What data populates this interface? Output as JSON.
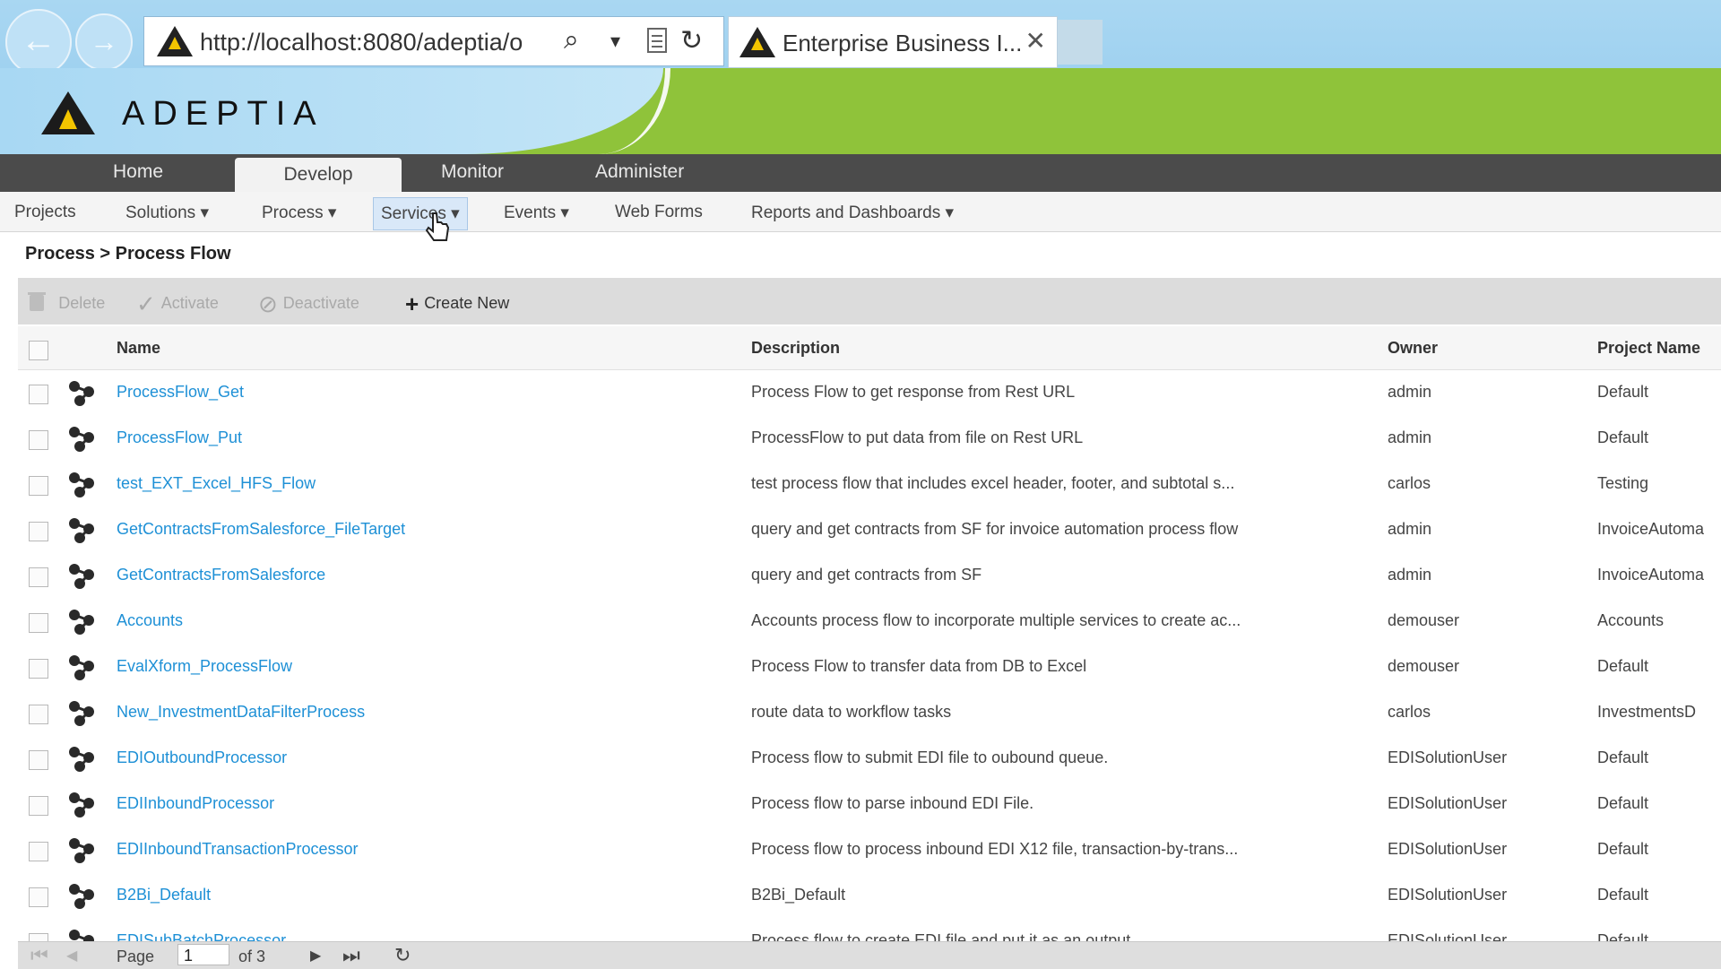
{
  "browser": {
    "url": "http://localhost:8080/adeptia/o",
    "tab_title": "Enterprise Business I...",
    "back_glyph": "←",
    "forward_glyph": "→",
    "search_glyph": "⌕",
    "dropdown_glyph": "▾",
    "refresh_glyph": "↻",
    "close_glyph": "✕"
  },
  "brand": {
    "name": "ADEPTIA"
  },
  "main_tabs": [
    {
      "label": "Home",
      "active": false
    },
    {
      "label": "Develop",
      "active": true
    },
    {
      "label": "Monitor",
      "active": false
    },
    {
      "label": "Administer",
      "active": false
    }
  ],
  "sub_nav": [
    {
      "label": "Projects"
    },
    {
      "label": "Solutions ▾"
    },
    {
      "label": "Process ▾"
    },
    {
      "label": "Services ▾",
      "hover": true
    },
    {
      "label": "Events ▾"
    },
    {
      "label": "Web Forms"
    },
    {
      "label": "Reports and Dashboards ▾"
    }
  ],
  "breadcrumb": "Process > Process Flow",
  "toolbar": {
    "delete_label": "Delete",
    "activate_label": "Activate",
    "deactivate_label": "Deactivate",
    "create_label": "Create New"
  },
  "grid": {
    "columns": [
      "Name",
      "Description",
      "Owner",
      "Project Name"
    ],
    "rows": [
      {
        "name": "ProcessFlow_Get",
        "description": "Process Flow to get response from Rest URL",
        "owner": "admin",
        "project": "Default"
      },
      {
        "name": "ProcessFlow_Put",
        "description": "ProcessFlow to put data from file on Rest URL",
        "owner": "admin",
        "project": "Default"
      },
      {
        "name": "test_EXT_Excel_HFS_Flow",
        "description": "test process flow that includes excel header, footer, and subtotal s...",
        "owner": "carlos",
        "project": "Testing"
      },
      {
        "name": "GetContractsFromSalesforce_FileTarget",
        "description": "query and get contracts from SF for invoice automation process flow",
        "owner": "admin",
        "project": "InvoiceAutoma"
      },
      {
        "name": "GetContractsFromSalesforce",
        "description": "query and get contracts from SF",
        "owner": "admin",
        "project": "InvoiceAutoma"
      },
      {
        "name": "Accounts",
        "description": "Accounts process flow to incorporate multiple services to create ac...",
        "owner": "demouser",
        "project": "Accounts"
      },
      {
        "name": "EvalXform_ProcessFlow",
        "description": "Process Flow to transfer data from DB to Excel",
        "owner": "demouser",
        "project": "Default"
      },
      {
        "name": "New_InvestmentDataFilterProcess",
        "description": "route data to workflow tasks",
        "owner": "carlos",
        "project": "InvestmentsD"
      },
      {
        "name": "EDIOutboundProcessor",
        "description": "Process flow to submit EDI file to oubound queue.",
        "owner": "EDISolutionUser",
        "project": "Default"
      },
      {
        "name": "EDIInboundProcessor",
        "description": "Process flow to parse inbound EDI File.",
        "owner": "EDISolutionUser",
        "project": "Default"
      },
      {
        "name": "EDIInboundTransactionProcessor",
        "description": "Process flow to process inbound EDI X12 file, transaction-by-trans...",
        "owner": "EDISolutionUser",
        "project": "Default"
      },
      {
        "name": "B2Bi_Default",
        "description": "B2Bi_Default",
        "owner": "EDISolutionUser",
        "project": "Default"
      },
      {
        "name": "EDISubBatchProcessor",
        "description": "Process flow to create EDI file and put it as an output",
        "owner": "EDISolutionUser",
        "project": "Default"
      }
    ]
  },
  "pager": {
    "page_label": "Page",
    "page_value": "1",
    "of_label": "of 3",
    "first_glyph": "⏮",
    "prev_glyph": "◀",
    "next_glyph": "▶",
    "last_glyph": "⏭",
    "refresh_glyph": "↻"
  },
  "colors": {
    "link": "#1e90d6",
    "banner_green": "#8fc33a",
    "banner_sky": "#a8d8f3",
    "nav_dark": "#4b4b4b"
  }
}
